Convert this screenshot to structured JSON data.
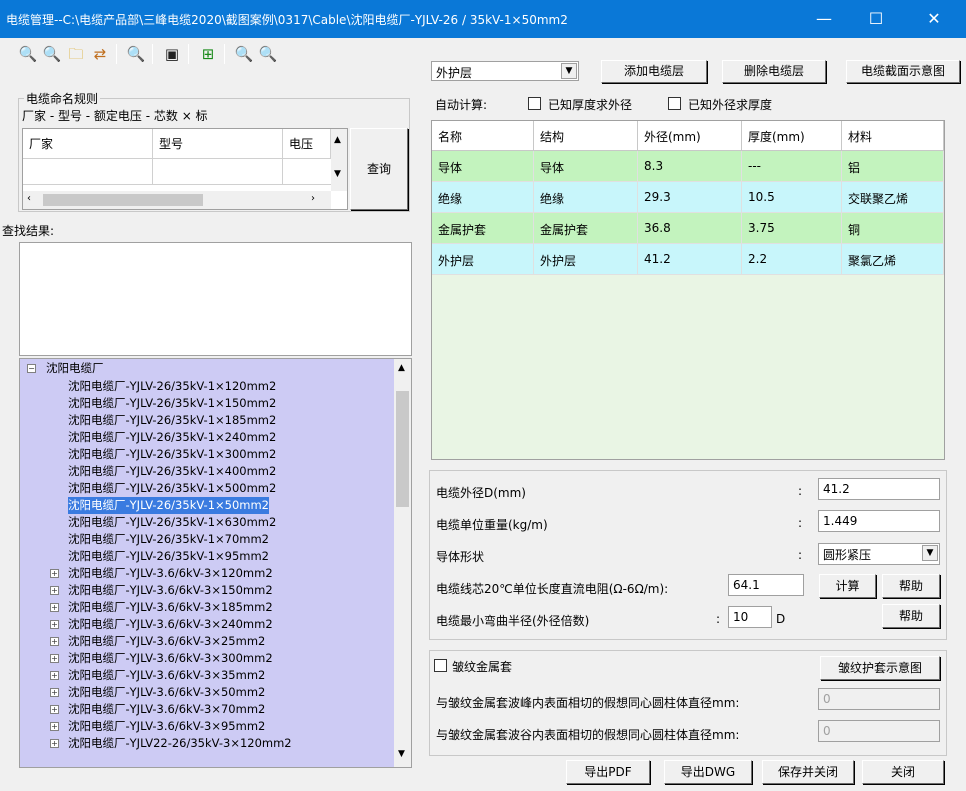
{
  "window": {
    "title": "电缆管理--C:\\电缆产品部\\三峰电缆2020\\截图案例\\0317\\Cable\\沈阳电缆厂-YJLV-26 / 35kV-1×50mm2",
    "minimize": "—",
    "maximize": "☐",
    "close": "✕"
  },
  "toolbar": {
    "icons": [
      "search-plus-icon",
      "search-minus-icon",
      "folder-icon",
      "transfer-icon",
      "zoom-in-icon",
      "save-icon",
      "export-icon",
      "zoom-plus-icon",
      "zoom-minus-icon"
    ]
  },
  "naming": {
    "group_label": "电缆命名规则",
    "rule": "厂家 - 型号 - 额定电压 - 芯数 × 标",
    "columns": [
      "厂家",
      "型号",
      "电压"
    ],
    "query_button": "查询"
  },
  "search": {
    "results_label": "查找结果:"
  },
  "tree": {
    "root": "沈阳电缆厂",
    "children": [
      "沈阳电缆厂-YJLV-26/35kV-1×120mm2",
      "沈阳电缆厂-YJLV-26/35kV-1×150mm2",
      "沈阳电缆厂-YJLV-26/35kV-1×185mm2",
      "沈阳电缆厂-YJLV-26/35kV-1×240mm2",
      "沈阳电缆厂-YJLV-26/35kV-1×300mm2",
      "沈阳电缆厂-YJLV-26/35kV-1×400mm2",
      "沈阳电缆厂-YJLV-26/35kV-1×500mm2",
      "沈阳电缆厂-YJLV-26/35kV-1×50mm2",
      "沈阳电缆厂-YJLV-26/35kV-1×630mm2",
      "沈阳电缆厂-YJLV-26/35kV-1×70mm2",
      "沈阳电缆厂-YJLV-26/35kV-1×95mm2"
    ],
    "selected_index": 7,
    "collapsed": [
      "沈阳电缆厂-YJLV-3.6/6kV-3×120mm2",
      "沈阳电缆厂-YJLV-3.6/6kV-3×150mm2",
      "沈阳电缆厂-YJLV-3.6/6kV-3×185mm2",
      "沈阳电缆厂-YJLV-3.6/6kV-3×240mm2",
      "沈阳电缆厂-YJLV-3.6/6kV-3×25mm2",
      "沈阳电缆厂-YJLV-3.6/6kV-3×300mm2",
      "沈阳电缆厂-YJLV-3.6/6kV-3×35mm2",
      "沈阳电缆厂-YJLV-3.6/6kV-3×50mm2",
      "沈阳电缆厂-YJLV-3.6/6kV-3×70mm2",
      "沈阳电缆厂-YJLV-3.6/6kV-3×95mm2",
      "沈阳电缆厂-YJLV22-26/35kV-3×120mm2"
    ]
  },
  "layers": {
    "selected": "外护层",
    "add_button": "添加电缆层",
    "delete_button": "删除电缆层",
    "diagram_button": "电缆截面示意图",
    "auto_calc_label": "自动计算:",
    "check_thickness": "已知厚度求外径",
    "check_diameter": "已知外径求厚度",
    "columns": [
      "名称",
      "结构",
      "外径(mm)",
      "厚度(mm)",
      "材料"
    ],
    "rows": [
      {
        "name": "导体",
        "structure": "导体",
        "diameter": "8.3",
        "thickness": "---",
        "material": "铝"
      },
      {
        "name": "绝缘",
        "structure": "绝缘",
        "diameter": "29.3",
        "thickness": "10.5",
        "material": "交联聚乙烯"
      },
      {
        "name": "金属护套",
        "structure": "金属护套",
        "diameter": "36.8",
        "thickness": "3.75",
        "material": "铜"
      },
      {
        "name": "外护层",
        "structure": "外护层",
        "diameter": "41.2",
        "thickness": "2.2",
        "material": "聚氯乙烯"
      }
    ]
  },
  "props": {
    "outer_diameter_label": "电缆外径D(mm)",
    "outer_diameter": "41.2",
    "unit_weight_label": "电缆单位重量(kg/m)",
    "unit_weight": "1.449",
    "conductor_shape_label": "导体形状",
    "conductor_shape": "圆形紧压",
    "resistance_label": "电缆线芯20℃单位长度直流电阻(Ω-6Ω/m):",
    "resistance": "64.1",
    "calc_button": "计算",
    "help_button": "帮助",
    "bend_radius_label": "电缆最小弯曲半径(外径倍数)",
    "bend_radius": "10",
    "bend_unit": "D",
    "help_button2": "帮助",
    "colon": ":"
  },
  "corrugated": {
    "checkbox_label": "皱纹金属套",
    "diagram_button": "皱纹护套示意图",
    "inner_label": "与皱纹金属套波峰内表面相切的假想同心圆柱体直径mm:",
    "inner_value": "0",
    "outer_label": "与皱纹金属套波谷内表面相切的假想同心圆柱体直径mm:",
    "outer_value": "0"
  },
  "footer": {
    "export_pdf": "导出PDF",
    "export_dwg": "导出DWG",
    "save_close": "保存并关闭",
    "close": "关闭"
  }
}
